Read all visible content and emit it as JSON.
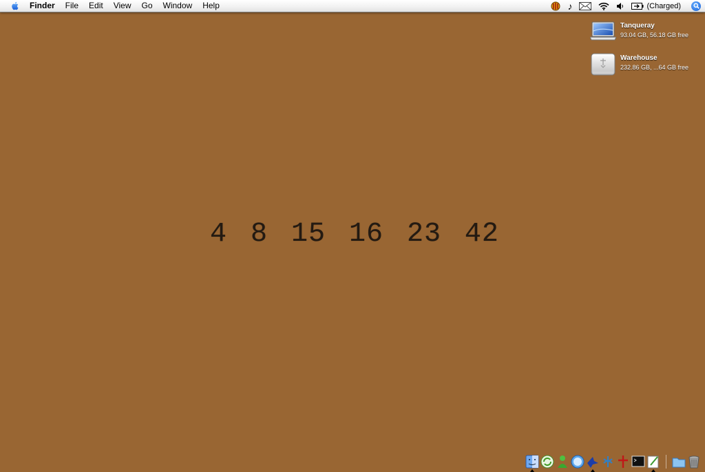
{
  "menubar": {
    "app_name": "Finder",
    "menus": [
      "File",
      "Edit",
      "View",
      "Go",
      "Window",
      "Help"
    ],
    "battery_status": "(Charged)"
  },
  "desktop": {
    "drives": [
      {
        "name": "Tanqueray",
        "info": "93.04 GB, 56.18 GB free",
        "icon": "laptop-drive-icon"
      },
      {
        "name": "Warehouse",
        "info": "232.86 GB, ...64 GB free",
        "icon": "firewire-drive-icon"
      }
    ],
    "numbers": [
      "4",
      "8",
      "15",
      "16",
      "23",
      "42"
    ],
    "background_color": "#996633"
  },
  "dock": {
    "items": [
      "finder-icon",
      "sync-icon",
      "ichat-icon",
      "safari-icon",
      "bird-icon",
      "network-icon",
      "pin-icon",
      "terminal-icon",
      "textedit-icon",
      "folder-icon",
      "trash-icon"
    ]
  }
}
